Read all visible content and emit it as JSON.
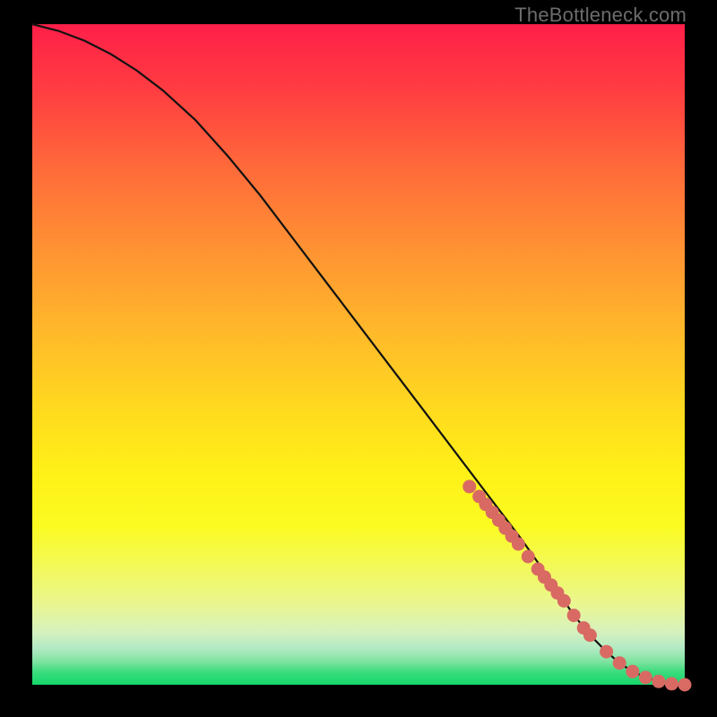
{
  "attribution": "TheBottleneck.com",
  "colors": {
    "frame_bg": "#000000",
    "curve_stroke": "#111111",
    "marker_fill": "#d96a63",
    "marker_stroke": "#c45a53"
  },
  "chart_data": {
    "type": "line",
    "title": "",
    "xlabel": "",
    "ylabel": "",
    "xlim": [
      0,
      100
    ],
    "ylim": [
      0,
      100
    ],
    "grid": false,
    "series": [
      {
        "name": "bottleneck-curve",
        "x": [
          0,
          4,
          8,
          12,
          16,
          20,
          25,
          30,
          35,
          40,
          45,
          50,
          55,
          60,
          65,
          70,
          75,
          80,
          83,
          86,
          88,
          90,
          92,
          94,
          96,
          98,
          100
        ],
        "values": [
          100,
          99,
          97.5,
          95.5,
          93,
          90,
          85.5,
          80,
          74,
          67.5,
          61,
          54.5,
          48,
          41.5,
          35,
          28.5,
          22,
          15,
          10.5,
          7,
          5,
          3.3,
          2,
          1.1,
          0.5,
          0.15,
          0
        ]
      }
    ],
    "markers": {
      "name": "highlighted-points",
      "x": [
        67,
        68.5,
        69.5,
        70.5,
        71.5,
        72.5,
        73.5,
        74.5,
        76,
        77.5,
        78.5,
        79.5,
        80.5,
        81.5,
        83,
        84.5,
        85.5,
        88,
        90,
        92,
        94,
        96,
        98,
        100
      ],
      "values": [
        30,
        28.5,
        27.3,
        26.1,
        24.9,
        23.7,
        22.5,
        21.3,
        19.4,
        17.5,
        16.3,
        15.1,
        13.9,
        12.7,
        10.5,
        8.6,
        7.5,
        5.0,
        3.3,
        2.0,
        1.1,
        0.5,
        0.15,
        0
      ]
    }
  }
}
